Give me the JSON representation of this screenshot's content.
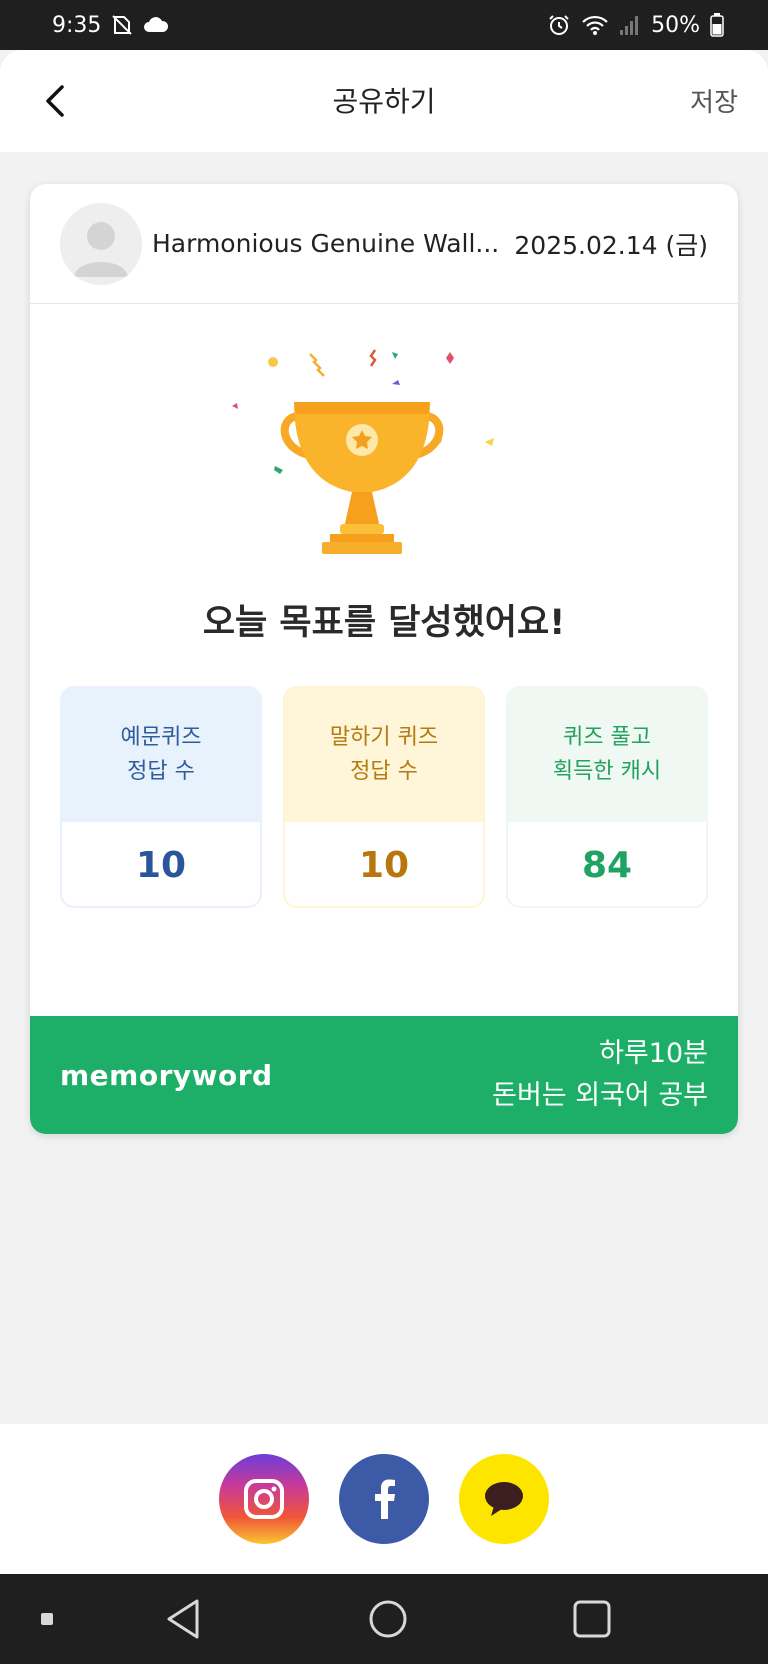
{
  "status_bar": {
    "time": "9:35",
    "battery": "50%"
  },
  "header": {
    "title": "공유하기",
    "save_label": "저장"
  },
  "card": {
    "username": "Harmonious Genuine Wall...",
    "date": "2025.02.14 (금)",
    "headline": "오늘 목표를 달성했어요!",
    "stats": [
      {
        "line1": "예문퀴즈",
        "line2": "정답 수",
        "value": "10",
        "color": "#2a5699"
      },
      {
        "line1": "말하기 퀴즈",
        "line2": "정답 수",
        "value": "10",
        "color": "#b8770c"
      },
      {
        "line1": "퀴즈 풀고",
        "line2": "획득한 캐시",
        "value": "84",
        "color": "#1fa362"
      }
    ],
    "footer": {
      "brand": "memoryword",
      "slogan_line1": "하루10분",
      "slogan_line2": "돈버는 외국어 공부",
      "color": "#1daf68"
    }
  },
  "share": {
    "buttons": [
      {
        "icon": "instagram-icon"
      },
      {
        "icon": "facebook-icon"
      },
      {
        "icon": "kakaotalk-icon"
      }
    ]
  },
  "nav": {
    "items": [
      {
        "icon": "recent-apps-dot-icon"
      },
      {
        "icon": "back-triangle-icon"
      },
      {
        "icon": "home-circle-icon"
      },
      {
        "icon": "overview-square-icon"
      }
    ]
  }
}
